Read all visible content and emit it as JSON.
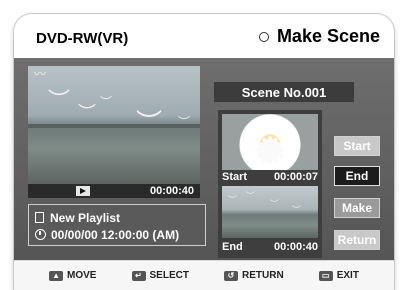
{
  "header": {
    "title": "DVD-RW(VR)",
    "mode_title": "Make Scene",
    "mode_icon": "circle-icon"
  },
  "player": {
    "time": "00:00:40",
    "play_icon": "play-icon"
  },
  "info": {
    "playlist_name": "New Playlist",
    "datetime": "00/00/00 12:00:00 (AM)"
  },
  "scene": {
    "label": "Scene No.001"
  },
  "thumbnails": {
    "start_label": "Start",
    "start_time": "00:00:07",
    "end_label": "End",
    "end_time": "00:00:40"
  },
  "buttons": {
    "start": "Start",
    "end": "End",
    "make": "Make",
    "return": "Return"
  },
  "footer": {
    "move": "MOVE",
    "select": "SELECT",
    "return": "RETURN",
    "exit": "EXIT"
  }
}
